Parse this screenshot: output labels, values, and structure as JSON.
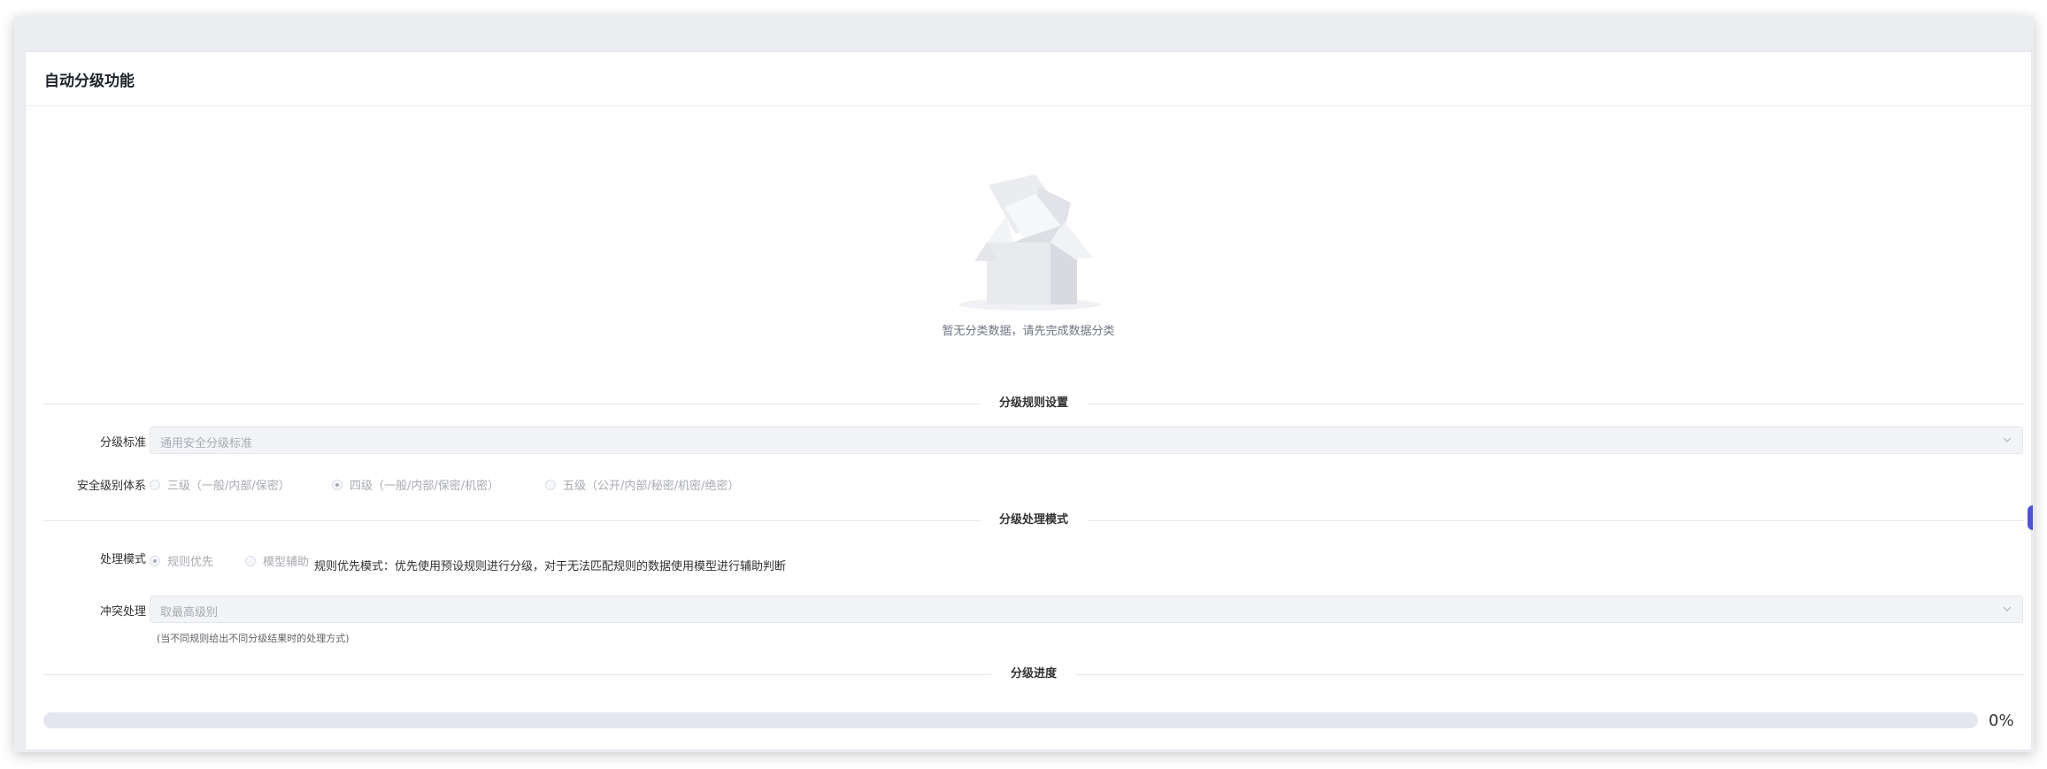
{
  "card": {
    "title": "自动分级功能"
  },
  "empty_state": {
    "icon": "empty-box-illustration",
    "description": "暂无分类数据，请先完成数据分类"
  },
  "sections": {
    "rules": "分级规则设置",
    "mode": "分级处理模式",
    "progress": "分级进度"
  },
  "grading_standard": {
    "label": "分级标准",
    "placeholder": "通用安全分级标准"
  },
  "security_level_system": {
    "label": "安全级别体系",
    "options": [
      {
        "label": "三级（一般/内部/保密）",
        "checked": false
      },
      {
        "label": "四级（一般/内部/保密/机密）",
        "checked": true
      },
      {
        "label": "五级（公开/内部/秘密/机密/绝密）",
        "checked": false
      }
    ]
  },
  "processing_mode": {
    "label": "处理模式",
    "options": [
      {
        "label": "规则优先",
        "checked": true
      },
      {
        "label": "模型辅助",
        "checked": false
      }
    ],
    "description": "规则优先模式：优先使用预设规则进行分级，对于无法匹配规则的数据使用模型进行辅助判断"
  },
  "conflict_handling": {
    "label": "冲突处理",
    "placeholder": "取最高级别",
    "hint": "(当不同规则给出不同分级结果时的处理方式)"
  },
  "progress": {
    "value": 0,
    "text": "0%"
  },
  "colors": {
    "accent": "#4f53d9",
    "disabled_text": "#a8abb2",
    "track": "#e4e6f0"
  }
}
